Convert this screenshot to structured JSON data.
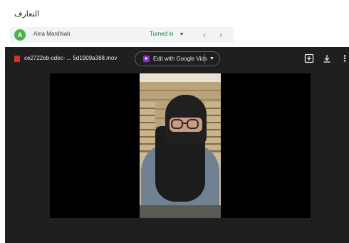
{
  "page": {
    "title": "التعارف"
  },
  "share_row": {
    "owner_initial": "A",
    "owner_name": "Aina Mardhiah",
    "status": "Turned in",
    "status_caret": "▼",
    "prev": "‹",
    "next": "›"
  },
  "viewer": {
    "file_name": "ce2722eb-cdec- ... 5d1909a388.mov",
    "edit_label": "Edit with Google Vids",
    "edit_caret": "▼",
    "more": "⋮"
  },
  "icons": {
    "file": "file-video-icon",
    "vids": "google-vids-icon",
    "add": "add-to-drive-icon",
    "download": "download-icon",
    "more": "more-vert-icon"
  },
  "colors": {
    "avatar": "#4caf50",
    "status": "#188038",
    "viewer_bg": "#1f1f1f",
    "file_icon": "#d93025",
    "vids_icon": "#8430ce"
  }
}
